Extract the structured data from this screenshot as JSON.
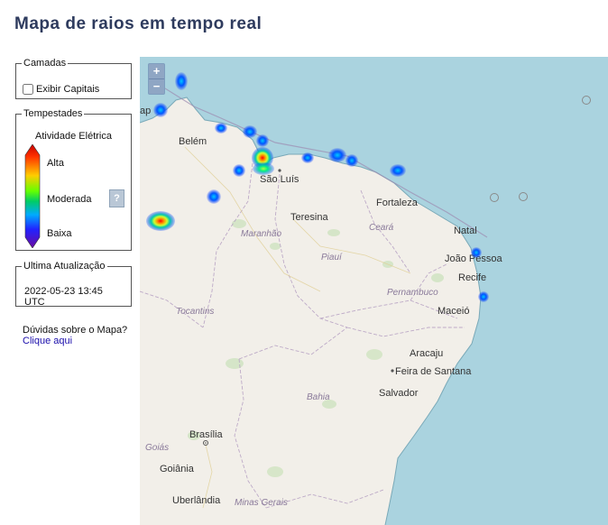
{
  "page": {
    "title": "Mapa de raios em tempo real"
  },
  "layers": {
    "legend": "Camadas",
    "checkbox_label": "Exibir Capitais",
    "checked": false
  },
  "storms": {
    "legend": "Tempestades",
    "scale_title": "Atividade Elétrica",
    "high": "Alta",
    "moderate": "Moderada",
    "low": "Baixa",
    "help_symbol": "?"
  },
  "update": {
    "legend": "Ultima Atualização",
    "value": "2022-05-23 13:45 UTC"
  },
  "help_box": {
    "question": "Dúvidas sobre o Mapa?",
    "link": "Clique aqui"
  },
  "map": {
    "zoom_in": "+",
    "zoom_out": "−",
    "cities": [
      "Belém",
      "São Luís",
      "Teresina",
      "Fortaleza",
      "Natal",
      "João Pessoa",
      "Recife",
      "Maceió",
      "Aracaju",
      "Feira de Santana",
      "Salvador",
      "Brasília",
      "Goiânia",
      "Uberlândia"
    ],
    "partial_city": "ap",
    "states": [
      "Maranhão",
      "Piauí",
      "Ceará",
      "Pernambuco",
      "Tocantins",
      "Bahia",
      "Goiás",
      "Minas Gerais"
    ],
    "colors": {
      "ocean": "#aad3df",
      "land": "#f2efe9",
      "storm_low": "#0044ff",
      "storm_high": "#ff0000"
    }
  }
}
